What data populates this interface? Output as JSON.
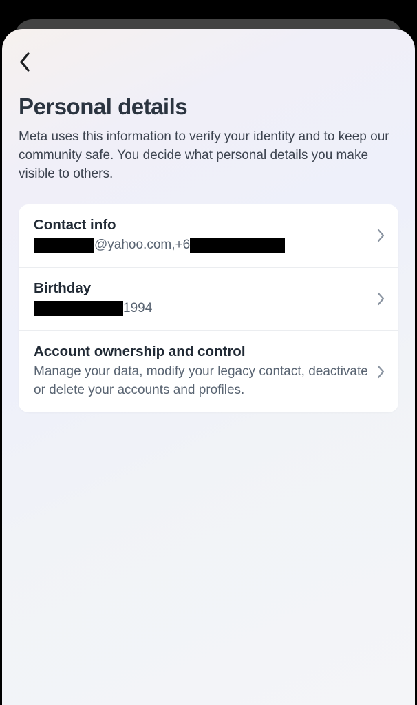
{
  "page": {
    "title": "Personal details",
    "subtitle": "Meta uses this information to verify your identity and to keep our community safe. You decide what personal details you make visible to others."
  },
  "items": [
    {
      "title": "Contact info",
      "value_parts": {
        "email_domain": "@yahoo.com, ",
        "phone_prefix": "+6"
      }
    },
    {
      "title": "Birthday",
      "value_parts": {
        "year": " 1994"
      }
    },
    {
      "title": "Account ownership and control",
      "description": "Manage your data, modify your legacy contact, deactivate or delete your accounts and profiles."
    }
  ]
}
